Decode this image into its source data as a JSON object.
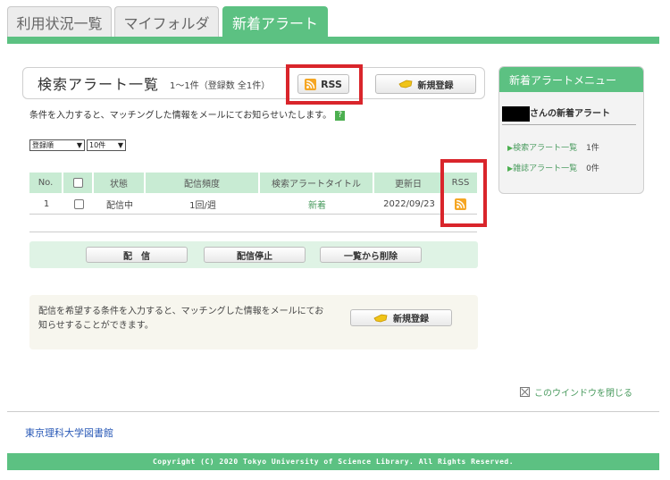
{
  "tabs": [
    {
      "label": "利用状況一覧"
    },
    {
      "label": "マイフォルダ"
    },
    {
      "label": "新着アラート"
    }
  ],
  "header": {
    "title": "検索アラート一覧",
    "count_text": "1～1件（登録数 全1件）",
    "rss_label": "RSS",
    "new_register_label": "新規登録"
  },
  "info_text": "条件を入力すると、マッチングした情報をメールにてお知らせいたします。",
  "help_icon": "?",
  "selects": {
    "sort": "登録順",
    "per_page": "10件"
  },
  "table": {
    "headers": [
      "No.",
      "",
      "状態",
      "配信頻度",
      "検索アラートタイトル",
      "更新日",
      "RSS"
    ],
    "rows": [
      {
        "no": "1",
        "status": "配信中",
        "frequency": "1回/週",
        "title": "新着",
        "updated": "2022/09/23"
      }
    ]
  },
  "actions": {
    "deliver": "配　信",
    "stop": "配信停止",
    "delete": "一覧から削除"
  },
  "notice": {
    "text": "配信を希望する条件を入力すると、マッチングした情報をメールにてお知らせすることができます。",
    "register_label": "新規登録"
  },
  "menu": {
    "title": "新着アラートメニュー",
    "user_suffix": "さんの新着アラート",
    "items": [
      {
        "label": "検索アラート一覧",
        "count": "1件"
      },
      {
        "label": "雑誌アラート一覧",
        "count": "0件"
      }
    ]
  },
  "close_window": "このウインドウを閉じる",
  "library_name": "東京理科大学図書館",
  "copyright": "Copyright (C) 2020 Tokyo University of Science Library. All Rights Reserved.",
  "colors": {
    "brand_green": "#5cc182",
    "highlight_red": "#d9252b",
    "rss_orange": "#f5a623"
  }
}
